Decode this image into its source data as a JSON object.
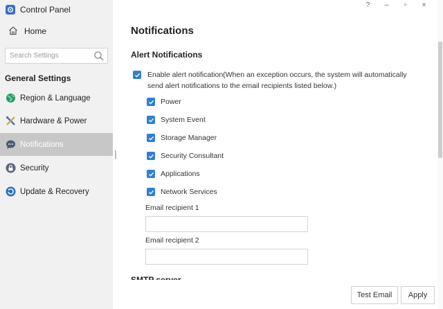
{
  "app": {
    "title": "Control Panel"
  },
  "window_controls": {
    "help": "?",
    "minimize": "–",
    "maximize": "▫",
    "close": "×"
  },
  "sidebar": {
    "home_label": "Home",
    "search_placeholder": "Search Settings",
    "section_heading": "General Settings",
    "items": [
      {
        "label": "Region & Language",
        "icon": "globe-icon",
        "active": false
      },
      {
        "label": "Hardware & Power",
        "icon": "tools-icon",
        "active": false
      },
      {
        "label": "Notifications",
        "icon": "chat-bubble-icon",
        "active": true
      },
      {
        "label": "Security",
        "icon": "lock-icon",
        "active": false
      },
      {
        "label": "Update & Recovery",
        "icon": "update-icon",
        "active": false
      }
    ]
  },
  "main": {
    "title": "Notifications",
    "alert_heading": "Alert Notifications",
    "enable_label": "Enable alert notification(When an exception occurs, the system will automatically send alert notifications to the email recipients listed below.)",
    "enable_checked": true,
    "categories": [
      {
        "label": "Power",
        "checked": true
      },
      {
        "label": "System Event",
        "checked": true
      },
      {
        "label": "Storage Manager",
        "checked": true
      },
      {
        "label": "Security Consultant",
        "checked": true
      },
      {
        "label": "Applications",
        "checked": true
      },
      {
        "label": "Network Services",
        "checked": true
      }
    ],
    "email_recipient_1_label": "Email recipient 1",
    "email_recipient_1_value": "",
    "email_recipient_2_label": "Email recipient 2",
    "email_recipient_2_value": "",
    "smtp_heading": "SMTP server"
  },
  "footer": {
    "test_email_label": "Test Email",
    "apply_label": "Apply"
  },
  "colors": {
    "accent": "#2f7ed8",
    "sidebar_bg": "#f1f1f1",
    "active_item_bg": "#c7c7c7"
  }
}
